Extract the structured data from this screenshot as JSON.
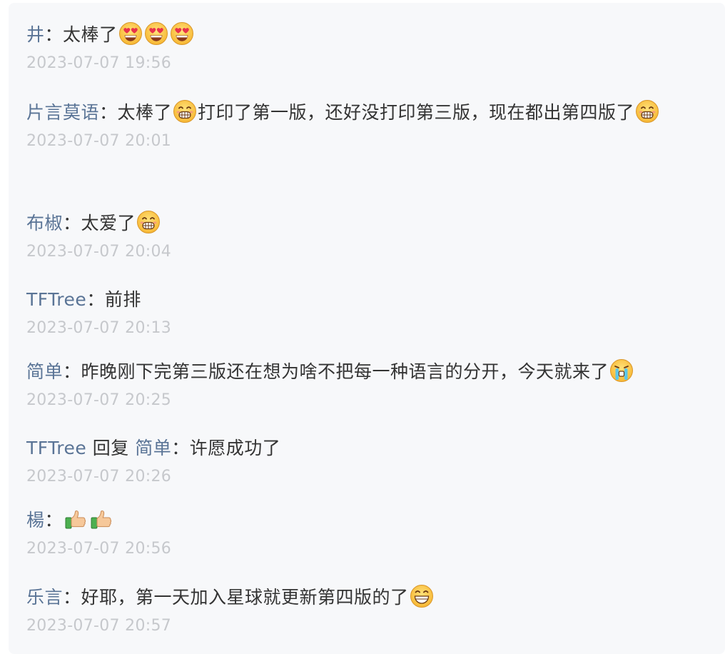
{
  "comments": [
    {
      "author": "井",
      "reply_word": "",
      "reply_to": "",
      "text": [
        "太棒了"
      ],
      "emojis": [
        [
          "heart-eyes-face-icon",
          "heart-eyes-face-icon",
          "heart-eyes-face-icon"
        ]
      ],
      "time": "2023-07-07 19:56"
    },
    {
      "author": "片言莫语",
      "reply_word": "",
      "reply_to": "",
      "text": [
        "太棒了",
        "打印了第一版，还好没打印第三版，现在都出第四版了"
      ],
      "emojis": [
        [
          "grin-face-icon"
        ],
        [
          "grin-face-icon"
        ]
      ],
      "time": "2023-07-07 20:01"
    },
    {
      "author": "布椒",
      "reply_word": "",
      "reply_to": "",
      "text": [
        "太爱了"
      ],
      "emojis": [
        [
          "grin-face-icon"
        ]
      ],
      "time": "2023-07-07 20:04"
    },
    {
      "author": "TFTree",
      "reply_word": "",
      "reply_to": "",
      "text": [
        "前排"
      ],
      "emojis": [],
      "time": "2023-07-07 20:13"
    },
    {
      "author": "简单",
      "reply_word": "",
      "reply_to": "",
      "text": [
        "昨晚刚下完第三版还在想为啥不把每一种语言的分开，今天就来了"
      ],
      "emojis": [
        [
          "crying-face-icon"
        ]
      ],
      "time": "2023-07-07 20:25"
    },
    {
      "author": "TFTree",
      "reply_word": "回复",
      "reply_to": "简单",
      "text": [
        "许愿成功了"
      ],
      "emojis": [],
      "time": "2023-07-07 20:26"
    },
    {
      "author": "楊",
      "reply_word": "",
      "reply_to": "",
      "text": [
        ""
      ],
      "emojis": [
        [
          "thumbs-up-icon",
          "thumbs-up-icon"
        ]
      ],
      "time": "2023-07-07 20:56"
    },
    {
      "author": "乐言",
      "reply_word": "",
      "reply_to": "",
      "text": [
        "好耶，第一天加入星球就更新第四版的了"
      ],
      "emojis": [
        [
          "laughing-face-icon"
        ]
      ],
      "time": "2023-07-07 20:57"
    }
  ],
  "colon": "：",
  "colors": {
    "author": "#5a7496",
    "text": "#333333",
    "time": "#c6c8cc",
    "panel": "#f7f8fa"
  }
}
